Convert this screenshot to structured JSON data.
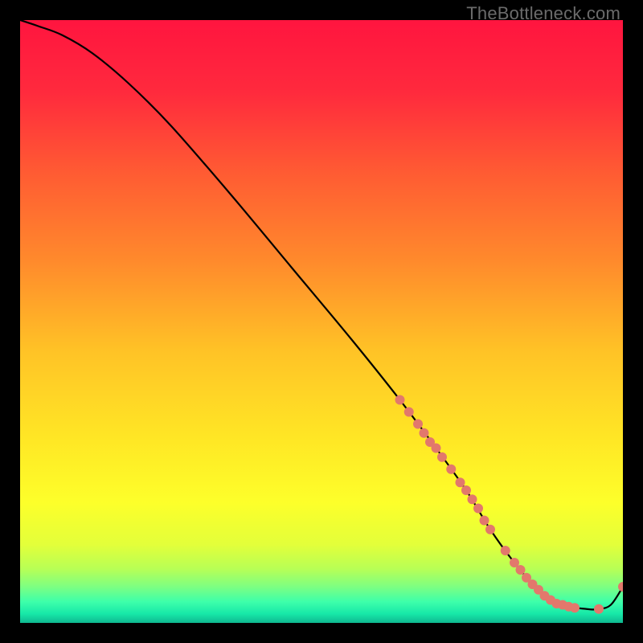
{
  "watermark": "TheBottleneck.com",
  "chart_data": {
    "type": "line",
    "title": "",
    "xlabel": "",
    "ylabel": "",
    "xlim": [
      0,
      100
    ],
    "ylim": [
      0,
      100
    ],
    "grid": false,
    "legend": false,
    "gradient_stops": [
      {
        "pos": 0.0,
        "color": "#ff153f"
      },
      {
        "pos": 0.12,
        "color": "#ff2a3d"
      },
      {
        "pos": 0.25,
        "color": "#ff5a33"
      },
      {
        "pos": 0.4,
        "color": "#ff8a2c"
      },
      {
        "pos": 0.55,
        "color": "#ffc326"
      },
      {
        "pos": 0.7,
        "color": "#ffe825"
      },
      {
        "pos": 0.8,
        "color": "#fdff2a"
      },
      {
        "pos": 0.87,
        "color": "#e3ff3a"
      },
      {
        "pos": 0.91,
        "color": "#b8ff55"
      },
      {
        "pos": 0.94,
        "color": "#7dff82"
      },
      {
        "pos": 0.965,
        "color": "#3dffaa"
      },
      {
        "pos": 0.985,
        "color": "#17e8a8"
      },
      {
        "pos": 1.0,
        "color": "#0fb890"
      }
    ],
    "series": [
      {
        "name": "bottleneck-curve",
        "color": "#000000",
        "x": [
          0,
          3,
          7,
          12,
          18,
          25,
          35,
          45,
          55,
          63,
          69,
          74,
          78,
          82,
          86,
          90,
          94,
          96,
          98,
          100
        ],
        "y": [
          100,
          99,
          97.5,
          94.5,
          89.5,
          82.5,
          71,
          59,
          47,
          37,
          29,
          22,
          15.5,
          10,
          5.5,
          3,
          2.3,
          2.3,
          3,
          6
        ]
      }
    ],
    "markers": {
      "color": "#e2786c",
      "radius_px": 6,
      "points": [
        {
          "x": 63,
          "y": 37
        },
        {
          "x": 64.5,
          "y": 35
        },
        {
          "x": 66,
          "y": 33
        },
        {
          "x": 67,
          "y": 31.5
        },
        {
          "x": 68,
          "y": 30
        },
        {
          "x": 69,
          "y": 29
        },
        {
          "x": 70,
          "y": 27.5
        },
        {
          "x": 71.5,
          "y": 25.5
        },
        {
          "x": 73,
          "y": 23.3
        },
        {
          "x": 74,
          "y": 22
        },
        {
          "x": 75,
          "y": 20.5
        },
        {
          "x": 76,
          "y": 19
        },
        {
          "x": 77,
          "y": 17
        },
        {
          "x": 78,
          "y": 15.5
        },
        {
          "x": 80.5,
          "y": 12
        },
        {
          "x": 82,
          "y": 10
        },
        {
          "x": 83,
          "y": 8.8
        },
        {
          "x": 84,
          "y": 7.5
        },
        {
          "x": 85,
          "y": 6.4
        },
        {
          "x": 86,
          "y": 5.5
        },
        {
          "x": 87,
          "y": 4.5
        },
        {
          "x": 88,
          "y": 3.8
        },
        {
          "x": 89,
          "y": 3.2
        },
        {
          "x": 90,
          "y": 3
        },
        {
          "x": 91,
          "y": 2.7
        },
        {
          "x": 92,
          "y": 2.5
        },
        {
          "x": 96,
          "y": 2.3
        },
        {
          "x": 100,
          "y": 6
        }
      ]
    }
  }
}
